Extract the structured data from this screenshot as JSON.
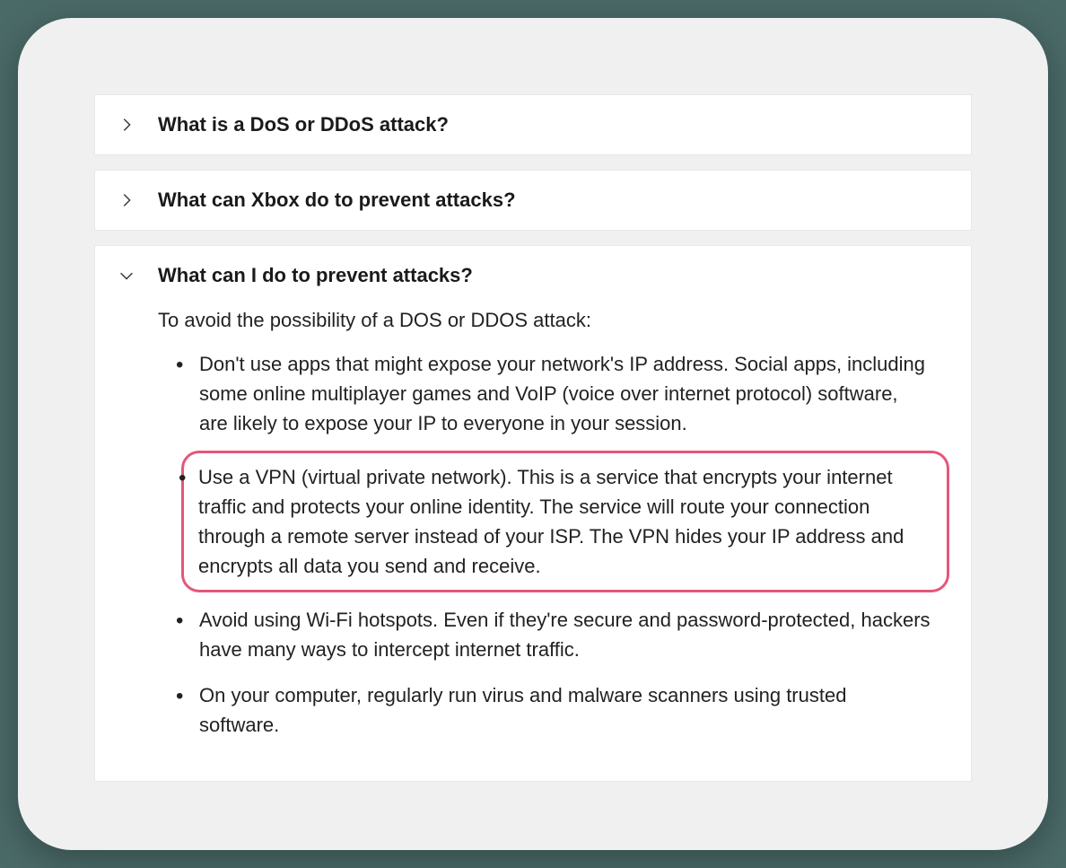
{
  "accordion": {
    "items": [
      {
        "title": "What is a DoS or DDoS attack?",
        "expanded": false
      },
      {
        "title": "What can Xbox do to prevent attacks?",
        "expanded": false
      },
      {
        "title": "What can I do to prevent attacks?",
        "expanded": true,
        "intro": "To avoid the possibility of a DOS or DDOS attack:",
        "bullets": [
          "Don't use apps that might expose your network's IP address. Social apps, including some online multiplayer games and VoIP (voice over internet protocol) software, are likely to expose your IP to everyone in your session.",
          "Use a VPN (virtual private network). This is a service that encrypts your internet traffic and protects your online identity. The service will route your connection through a remote server instead of your ISP. The VPN hides your IP address and encrypts all data you send and receive.",
          "Avoid using Wi-Fi hotspots. Even if they're secure and password-protected, hackers have many ways to intercept internet traffic.",
          "On your computer, regularly run virus and malware scanners using trusted software."
        ]
      }
    ]
  }
}
